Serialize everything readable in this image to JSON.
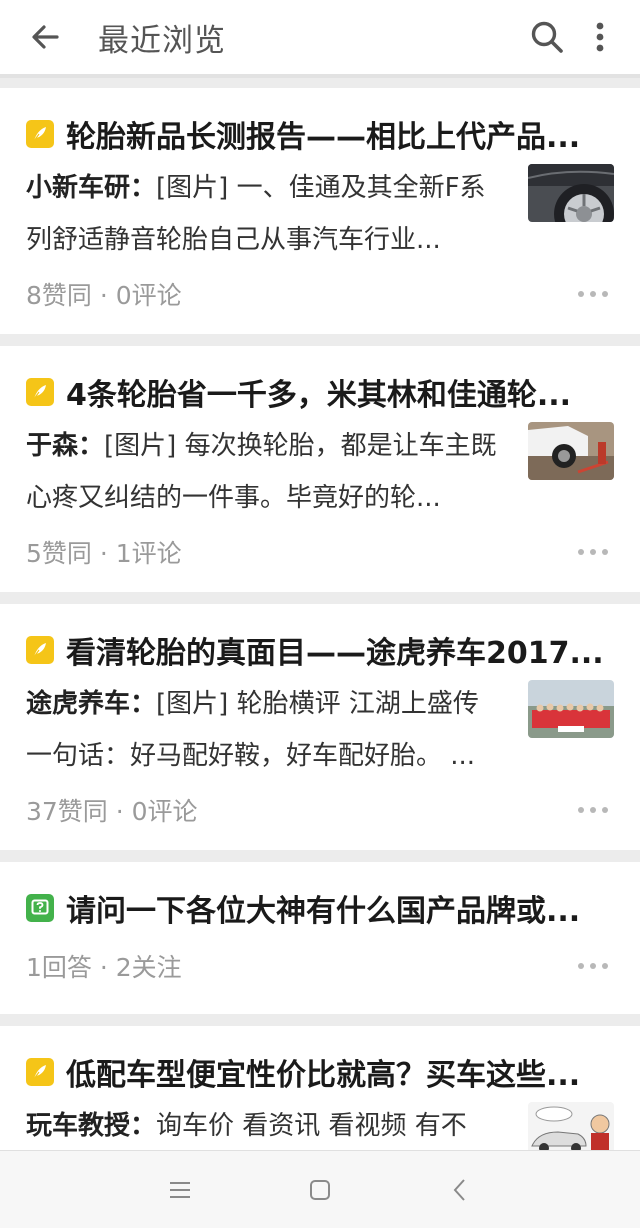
{
  "header": {
    "title": "最近浏览"
  },
  "feed": [
    {
      "type": "article",
      "title": "轮胎新品长测报告——相比上代产品...",
      "author": "小新车研：",
      "excerpt": "[图片] 一、佳通及其全新F系列舒适静音轮胎自己从事汽车行业...",
      "stats": "8赞同 · 0评论",
      "thumb": "tire-closeup"
    },
    {
      "type": "article",
      "title": "4条轮胎省一千多，米其林和佳通轮...",
      "author": "于森：",
      "excerpt": "[图片] 每次换轮胎，都是让车主既心疼又纠结的一件事。毕竟好的轮...",
      "stats": "5赞同 · 1评论",
      "thumb": "car-jack"
    },
    {
      "type": "article",
      "title": "看清轮胎的真面目——途虎养车2017...",
      "author": "途虎养车：",
      "excerpt": "[图片] 轮胎横评 江湖上盛传一句话：好马配好鞍，好车配好胎。 ...",
      "stats": "37赞同 · 0评论",
      "thumb": "group-photo"
    },
    {
      "type": "question",
      "title": "请问一下各位大神有什么国产品牌或...",
      "stats": "1回答 · 2关注"
    },
    {
      "type": "article",
      "title": "低配车型便宜性价比就高？买车这些...",
      "author": "玩车教授：",
      "excerpt": "询车价 看资讯 看视频 有不",
      "thumb": "cartoon-car"
    }
  ],
  "icons": {
    "back": "arrow-left-icon",
    "search": "search-icon",
    "more": "more-vertical-icon",
    "nav_menu": "menu-icon",
    "nav_home": "home-square-icon",
    "nav_back": "chevron-left-icon"
  },
  "colors": {
    "article_badge": "#f5c518",
    "question_badge": "#43b24b"
  }
}
